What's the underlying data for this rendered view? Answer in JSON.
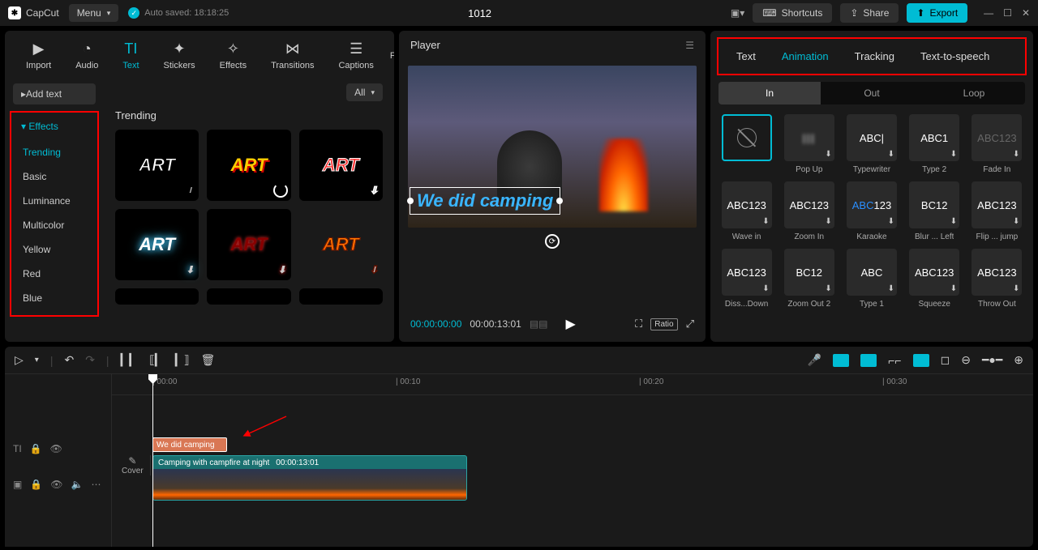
{
  "topbar": {
    "app_name": "CapCut",
    "menu_label": "Menu",
    "auto_saved": "Auto saved: 18:18:25",
    "project_title": "1012",
    "shortcuts": "Shortcuts",
    "share": "Share",
    "export": "Export"
  },
  "category_tabs": {
    "import": "Import",
    "audio": "Audio",
    "text": "Text",
    "stickers": "Stickers",
    "effects": "Effects",
    "transitions": "Transitions",
    "captions": "Captions",
    "filters_initial": "F"
  },
  "left_panel": {
    "add_text": "Add text",
    "all_label": "All",
    "effects_header": "Effects",
    "sub_items": [
      "Trending",
      "Basic",
      "Luminance",
      "Multicolor",
      "Yellow",
      "Red",
      "Blue"
    ],
    "trending_title": "Trending"
  },
  "player": {
    "title": "Player",
    "overlay_text": "We did camping",
    "current_time": "00:00:00:00",
    "total_time": "00:00:13:01",
    "ratio_label": "Ratio"
  },
  "right_panel": {
    "tabs": [
      "Text",
      "Animation",
      "Tracking",
      "Text-to-speech"
    ],
    "active_tab": "Animation",
    "mode_tabs": [
      "In",
      "Out",
      "Loop"
    ],
    "active_mode": "In",
    "animations": [
      {
        "label": "",
        "text": "",
        "none": true,
        "selected": true
      },
      {
        "label": "Pop Up",
        "text": "",
        "blur": true
      },
      {
        "label": "Typewriter",
        "text": "ABC|"
      },
      {
        "label": "Type 2",
        "text": "ABC1"
      },
      {
        "label": "Fade In",
        "text": "ABC123",
        "faded": true
      },
      {
        "label": "Wave in",
        "text": "ABC123"
      },
      {
        "label": "Zoom In",
        "text": "ABC123"
      },
      {
        "label": "Karaoke",
        "text": "ABC123",
        "accent": true
      },
      {
        "label": "Blur ... Left",
        "text": "BC12"
      },
      {
        "label": "Flip ... jump",
        "text": "ABC123"
      },
      {
        "label": "Diss...Down",
        "text": "ABC123"
      },
      {
        "label": "Zoom Out 2",
        "text": "BC12"
      },
      {
        "label": "Type 1",
        "text": "ABC"
      },
      {
        "label": "Squeeze",
        "text": "ABC123"
      },
      {
        "label": "Throw Out",
        "text": "ABC123"
      }
    ]
  },
  "timeline": {
    "ruler": [
      {
        "pos": 50,
        "label": "00:00"
      },
      {
        "pos": 350,
        "label": "00:10"
      },
      {
        "pos": 650,
        "label": "00:20"
      },
      {
        "pos": 950,
        "label": "00:30"
      }
    ],
    "cover_label": "Cover",
    "text_clip_label": "We did camping",
    "video_clip_title": "Camping with campfire at night",
    "video_clip_duration": "00:00:13:01"
  }
}
